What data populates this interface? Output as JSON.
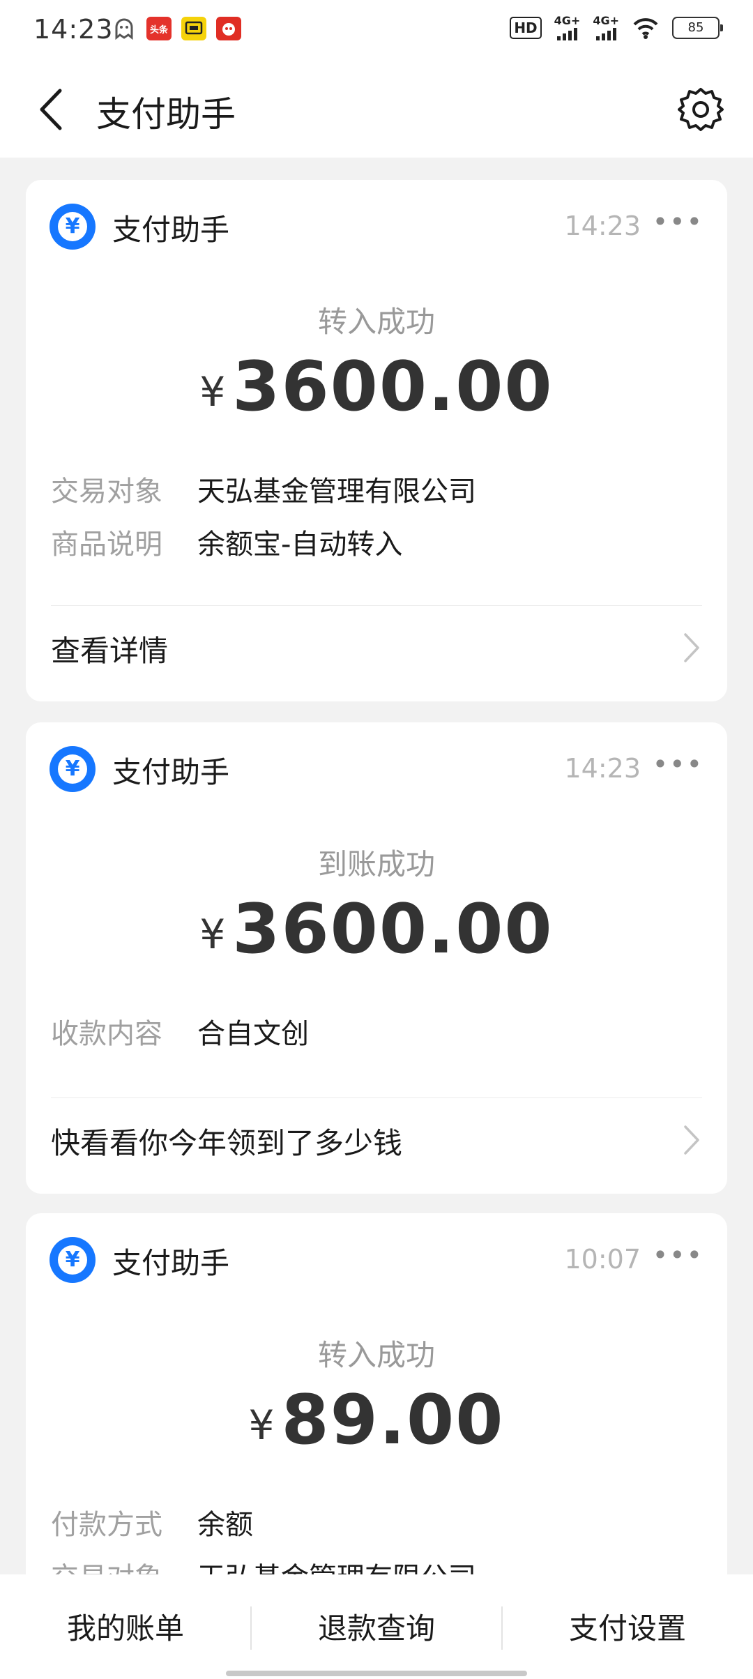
{
  "status_bar": {
    "time": "14:23",
    "left_icons": [
      "ghost-icon",
      "toutiao-app-icon",
      "tv-app-icon",
      "pinduoduo-app-icon"
    ],
    "toutiao_text": "头条",
    "hd_label": "HD",
    "net1": "4G+",
    "net2": "4G+",
    "battery": "85"
  },
  "header": {
    "title": "支付助手"
  },
  "cards": [
    {
      "sender": "支付助手",
      "time": "14:23",
      "status": "转入成功",
      "currency": "¥",
      "amount": "3600.00",
      "rows": [
        {
          "key": "交易对象",
          "value": "天弘基金管理有限公司"
        },
        {
          "key": "商品说明",
          "value": "余额宝-自动转入"
        }
      ],
      "link": "查看详情"
    },
    {
      "sender": "支付助手",
      "time": "14:23",
      "status": "到账成功",
      "currency": "¥",
      "amount": "3600.00",
      "rows": [
        {
          "key": "收款内容",
          "value": "合自文创"
        }
      ],
      "link": "快看看你今年领到了多少钱"
    },
    {
      "sender": "支付助手",
      "time": "10:07",
      "status": "转入成功",
      "currency": "¥",
      "amount": "89.00",
      "rows": [
        {
          "key": "付款方式",
          "value": "余额"
        },
        {
          "key": "交易对象",
          "value": "天弘基金管理有限公司"
        }
      ]
    }
  ],
  "bottom_tabs": [
    {
      "label": "我的账单"
    },
    {
      "label": "退款查询"
    },
    {
      "label": "支付设置"
    }
  ],
  "colors": {
    "accent": "#1677ff",
    "background": "#f2f2f2",
    "card": "#ffffff",
    "muted_text": "#a0a0a0"
  }
}
